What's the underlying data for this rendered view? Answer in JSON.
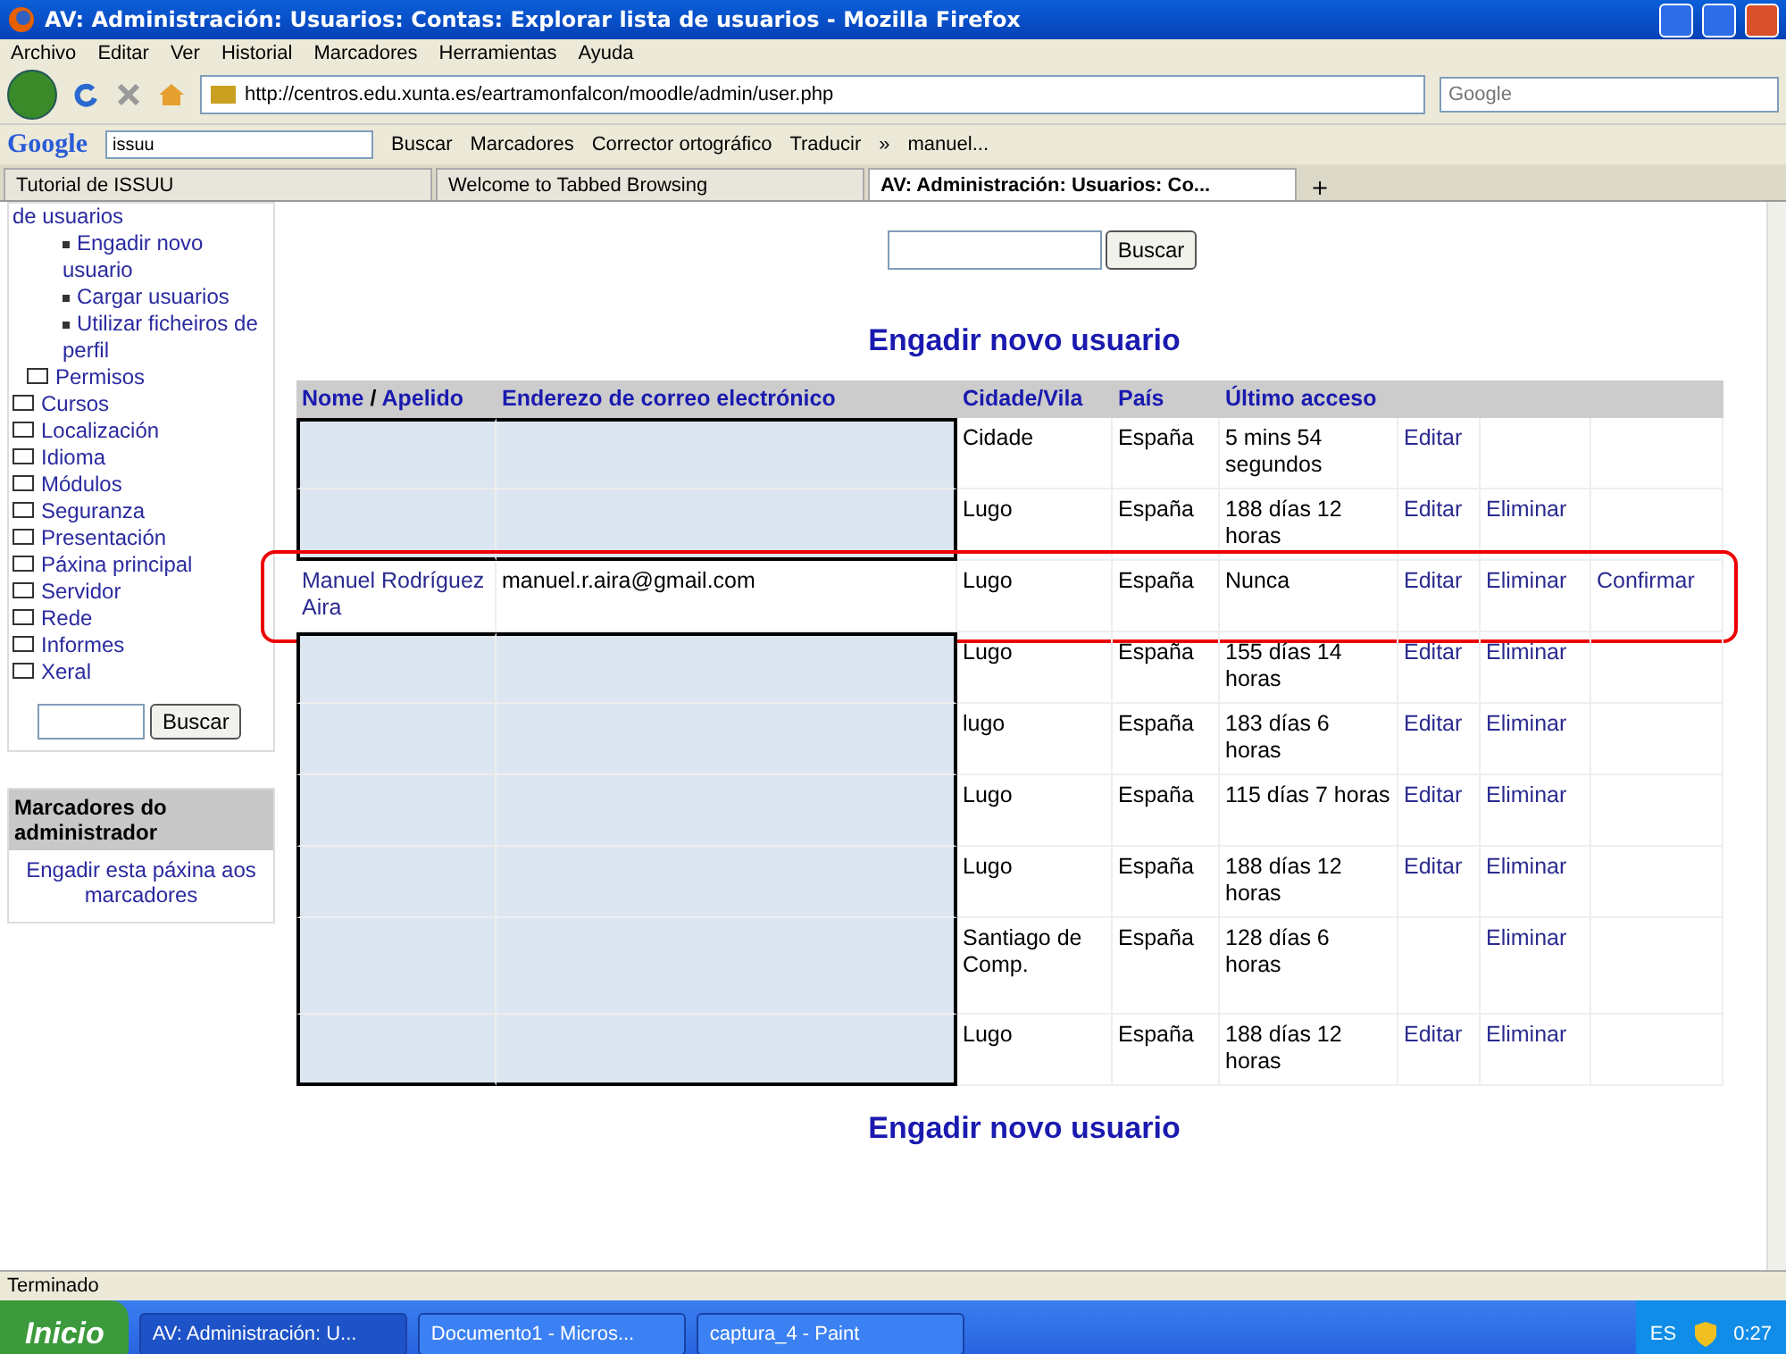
{
  "window": {
    "title": "AV: Administración: Usuarios: Contas: Explorar lista de usuarios - Mozilla Firefox"
  },
  "menu": [
    "Archivo",
    "Editar",
    "Ver",
    "Historial",
    "Marcadores",
    "Herramientas",
    "Ayuda"
  ],
  "nav": {
    "url": "http://centros.edu.xunta.es/eartramonfalcon/moodle/admin/user.php",
    "search_placeholder": "Google"
  },
  "google_toolbar": {
    "logo": "Google",
    "query": "issuu",
    "items": [
      "Buscar",
      "Marcadores",
      "Corrector ortográfico",
      "Traducir",
      "»",
      "manuel..."
    ]
  },
  "tabs": [
    {
      "label": "Tutorial de ISSUU",
      "selected": false
    },
    {
      "label": "Welcome to Tabbed Browsing",
      "selected": false
    },
    {
      "label": "AV: Administración: Usuarios: Co...",
      "selected": true
    }
  ],
  "new_tab": "+",
  "sidebar": {
    "items": [
      {
        "kind": "link",
        "label": "de usuarios"
      },
      {
        "kind": "bullet",
        "label": "Engadir novo usuario"
      },
      {
        "kind": "bullet",
        "label": "Cargar usuarios"
      },
      {
        "kind": "bullet",
        "label": "Utilizar ficheiros de perfil"
      },
      {
        "kind": "subfolder",
        "label": "Permisos"
      },
      {
        "kind": "folder",
        "label": "Cursos"
      },
      {
        "kind": "folder",
        "label": "Localización"
      },
      {
        "kind": "folder",
        "label": "Idioma"
      },
      {
        "kind": "folder",
        "label": "Módulos"
      },
      {
        "kind": "folder",
        "label": "Seguranza"
      },
      {
        "kind": "folder",
        "label": "Presentación"
      },
      {
        "kind": "folder",
        "label": "Páxina principal"
      },
      {
        "kind": "folder",
        "label": "Servidor"
      },
      {
        "kind": "folder",
        "label": "Rede"
      },
      {
        "kind": "folder",
        "label": "Informes"
      },
      {
        "kind": "folder",
        "label": "Xeral"
      }
    ],
    "search_button": "Buscar",
    "bookmarks_block": {
      "title": "Marcadores do administrador",
      "link": "Engadir esta páxina aos marcadores"
    }
  },
  "search_button": "Buscar",
  "heading": "Engadir novo usuario",
  "table": {
    "columns": [
      {
        "parts": [
          "Nome",
          "/",
          "Apelido"
        ]
      },
      {
        "parts": [
          "Enderezo de correo electrónico"
        ]
      },
      {
        "parts": [
          "Cidade/Vila"
        ]
      },
      {
        "parts": [
          "País"
        ]
      },
      {
        "parts": [
          "Último acceso"
        ]
      }
    ],
    "rows": [
      {
        "redacted": true,
        "highlighted": false,
        "city": "Cidade",
        "country": "España",
        "last_access": "5 mins 54 segundos",
        "edit": "Editar"
      },
      {
        "redacted": true,
        "highlighted": false,
        "city": "Lugo",
        "country": "España",
        "last_access": "188 días 12 horas",
        "edit": "Editar",
        "delete": "Eliminar"
      },
      {
        "redacted": false,
        "highlighted": true,
        "name": "Manuel Rodríguez Aira",
        "email": "manuel.r.aira@gmail.com",
        "city": "Lugo",
        "country": "España",
        "last_access": "Nunca",
        "edit": "Editar",
        "delete": "Eliminar",
        "confirm": "Confirmar"
      },
      {
        "redacted": true,
        "highlighted": false,
        "city": "Lugo",
        "country": "España",
        "last_access": "155 días 14 horas",
        "edit": "Editar",
        "delete": "Eliminar"
      },
      {
        "redacted": true,
        "highlighted": false,
        "city": "lugo",
        "country": "España",
        "last_access": "183 días 6 horas",
        "edit": "Editar",
        "delete": "Eliminar"
      },
      {
        "redacted": true,
        "highlighted": false,
        "city": "Lugo",
        "country": "España",
        "last_access": "115 días 7 horas",
        "edit": "Editar",
        "delete": "Eliminar"
      },
      {
        "redacted": true,
        "highlighted": false,
        "city": "Lugo",
        "country": "España",
        "last_access": "188 días 12 horas",
        "edit": "Editar",
        "delete": "Eliminar"
      },
      {
        "redacted": true,
        "highlighted": false,
        "city": "Santiago de Comp.",
        "country": "España",
        "last_access": "128 días 6 horas",
        "delete": "Eliminar"
      },
      {
        "redacted": true,
        "highlighted": false,
        "city": "Lugo",
        "country": "España",
        "last_access": "188 días 12 horas",
        "edit": "Editar",
        "delete": "Eliminar"
      }
    ]
  },
  "footer_heading": "Engadir novo usuario",
  "status_bar": "Terminado",
  "taskbar": {
    "start": "Inicio",
    "tasks": [
      {
        "label": "AV: Administración: U...",
        "selected": true
      },
      {
        "label": "Documento1 - Micros...",
        "selected": false
      },
      {
        "label": "captura_4 - Paint",
        "selected": false
      }
    ],
    "language": "ES",
    "clock": "0:27"
  }
}
